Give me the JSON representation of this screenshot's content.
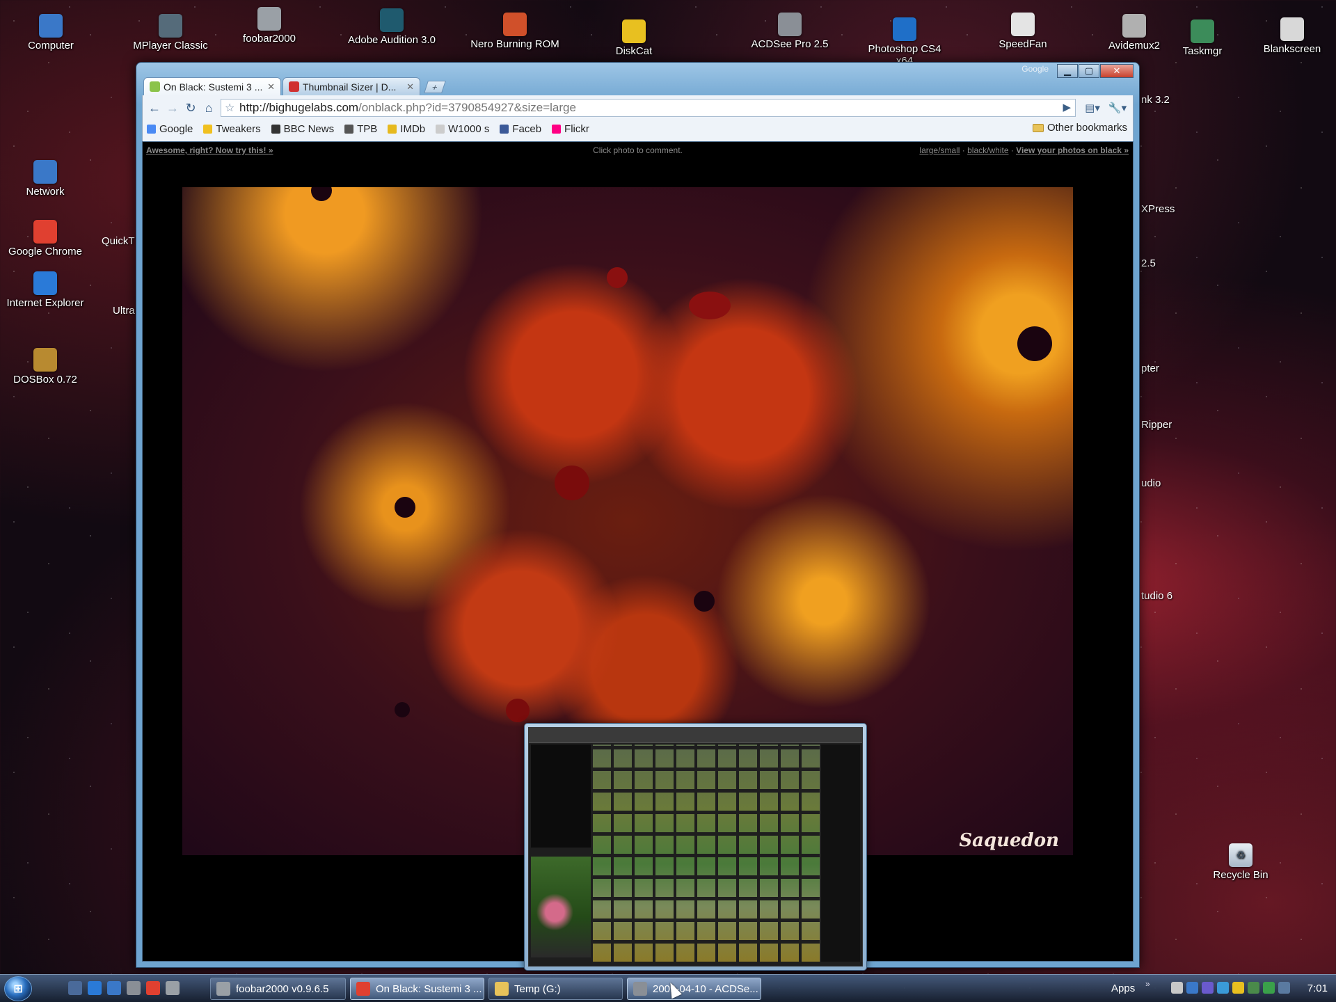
{
  "desktop": {
    "top_icons": [
      {
        "label": "Computer",
        "icon": "computer-icon",
        "color": "#3a78c8"
      },
      {
        "label": "MPlayer Classic",
        "icon": "mplayer-icon",
        "color": "#556b7a"
      },
      {
        "label": "foobar2000",
        "icon": "foobar-icon",
        "color": "#9aa0a6"
      },
      {
        "label": "Adobe Audition 3.0",
        "icon": "audition-icon",
        "color": "#1f5a6e"
      },
      {
        "label": "Nero Burning ROM",
        "icon": "nero-icon",
        "color": "#d0502a"
      },
      {
        "label": "DiskCat",
        "icon": "diskcat-icon",
        "color": "#e8c020"
      },
      {
        "label": "ACDSee Pro 2.5",
        "icon": "acdsee-icon",
        "color": "#8a8f96"
      },
      {
        "label": "Photoshop CS4 x64",
        "icon": "photoshop-icon",
        "color": "#1f6fc8"
      },
      {
        "label": "SpeedFan",
        "icon": "speedfan-icon",
        "color": "#e4e4e4"
      },
      {
        "label": "Avidemux2",
        "icon": "avidemux-icon",
        "color": "#b0b0b0"
      },
      {
        "label": "Taskmgr",
        "icon": "taskmgr-icon",
        "color": "#3c8c5a"
      },
      {
        "label": "Blankscreen",
        "icon": "blankscreen-icon",
        "color": "#d8d8d8"
      }
    ],
    "left_icons": [
      {
        "label": "Network",
        "icon": "network-icon",
        "color": "#3a78c8"
      },
      {
        "label": "Google Chrome",
        "icon": "chrome-icon",
        "color": "#e04030"
      },
      {
        "label": "Internet Explorer",
        "icon": "ie-icon",
        "color": "#2a7ad8"
      },
      {
        "label": "DOSBox 0.72",
        "icon": "dosbox-icon",
        "color": "#b88a30"
      }
    ],
    "partial_left": [
      "QuickT",
      "Ultra"
    ],
    "partial_right": [
      "nk 3.2",
      "XPress",
      "2.5",
      "pter",
      "Ripper",
      "udio",
      "tudio 6"
    ],
    "recycle_bin": {
      "label": "Recycle Bin",
      "icon": "recycle-bin-icon"
    }
  },
  "browser": {
    "corner_label": "Google",
    "tabs": [
      {
        "title": "On Black: Sustemi 3 ...",
        "active": true,
        "favicon_color": "#8bc34a"
      },
      {
        "title": "Thumbnail Sizer | D...",
        "active": false,
        "favicon_color": "#d03030"
      }
    ],
    "url_host": "http://bighugelabs.com",
    "url_path": "/onblack.php?id=3790854927&size=large",
    "bookmarks": [
      {
        "label": "Google",
        "color": "#4a8af4"
      },
      {
        "label": "Tweakers",
        "color": "#f0c020"
      },
      {
        "label": "BBC News",
        "color": "#333333"
      },
      {
        "label": "TPB",
        "color": "#555555"
      },
      {
        "label": "IMDb",
        "color": "#e6b91e"
      },
      {
        "label": "W1000 s",
        "color": "#cccccc"
      },
      {
        "label": "Faceb",
        "color": "#3b5998"
      },
      {
        "label": "Flickr",
        "color": "#ff0084"
      }
    ],
    "other_bookmarks": "Other bookmarks"
  },
  "page": {
    "left_link": "Awesome, right? Now try this!",
    "left_arrow": "»",
    "center_text": "Click photo to comment.",
    "right_large": "large",
    "right_sep1": "/",
    "right_small": "small",
    "right_dot1": " · ",
    "right_bw": "black/white",
    "right_dot2": " · ",
    "right_view": "View your photos on black",
    "right_arrow": " »",
    "signature": "Saquedon"
  },
  "taskbar": {
    "buttons": [
      {
        "label": "foobar2000 v0.9.6.5",
        "color": "#9aa0a6"
      },
      {
        "label": "On Black: Sustemi 3 ...",
        "color": "#e04030"
      },
      {
        "label": "Temp (G:)",
        "color": "#e8c35a"
      },
      {
        "label": "2009-04-10 - ACDSe...",
        "color": "#8a8f96"
      }
    ],
    "tray_label": "Apps",
    "tray_chevron": "»",
    "clock": "7:01"
  }
}
